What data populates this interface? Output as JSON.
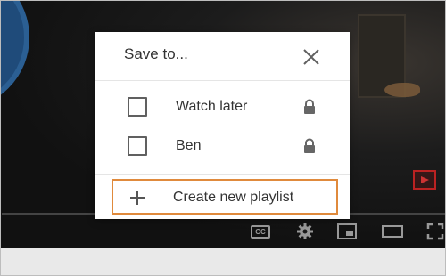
{
  "dialog": {
    "title": "Save to...",
    "close_icon": "close-icon",
    "playlists": [
      {
        "label": "Watch later",
        "checked": false,
        "privacy_icon": "lock-icon"
      },
      {
        "label": "Ben",
        "checked": false,
        "privacy_icon": "lock-icon"
      }
    ],
    "create_label": "Create new playlist",
    "create_icon": "plus-icon",
    "highlight_color": "#e08a3c"
  },
  "player_controls": {
    "icons": [
      "subtitles-icon",
      "settings-icon",
      "miniplayer-icon",
      "theater-mode-icon",
      "fullscreen-icon"
    ],
    "cc_label": "CC"
  }
}
